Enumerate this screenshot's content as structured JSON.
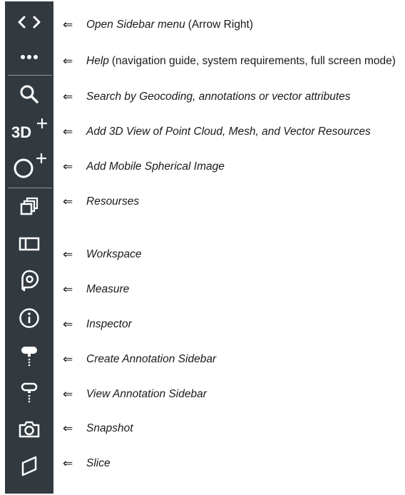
{
  "arrow_glyph": "⇐",
  "toolbar": {
    "threed_label": "3D",
    "plus_glyph": "+",
    "icons": [
      "code-chevrons-icon",
      "more-dots-icon",
      "search-icon",
      "add-3d-view-icon",
      "add-spherical-image-icon",
      "resources-icon",
      "workspace-icon",
      "measure-icon",
      "inspector-icon",
      "create-annotation-icon",
      "view-annotation-icon",
      "snapshot-icon",
      "slice-icon"
    ]
  },
  "legend": [
    {
      "italic": "Open Sidebar menu",
      "plain": "(Arrow Right)"
    },
    {
      "italic": "Help",
      "plain": "(navigation guide, system requirements, full screen mode)"
    },
    {
      "italic": "Search by Geocoding, annotations or vector attributes",
      "plain": ""
    },
    {
      "italic": "Add 3D View of Point Cloud, Mesh, and Vector Resources",
      "plain": ""
    },
    {
      "italic": "Add Mobile Spherical Image",
      "plain": ""
    },
    {
      "italic": "Resourses",
      "plain": ""
    },
    {
      "italic": "Workspace",
      "plain": ""
    },
    {
      "italic": "Measure",
      "plain": ""
    },
    {
      "italic": "Inspector",
      "plain": ""
    },
    {
      "italic": "Create Annotation Sidebar",
      "plain": ""
    },
    {
      "italic": "View Annotation Sidebar",
      "plain": ""
    },
    {
      "italic": "Snapshot",
      "plain": ""
    },
    {
      "italic": "Slice",
      "plain": ""
    }
  ],
  "colors": {
    "sidebar_bg": "#323a40",
    "icon": "#ffffff",
    "separator": "#8a949c",
    "text": "#1a1a1a"
  }
}
